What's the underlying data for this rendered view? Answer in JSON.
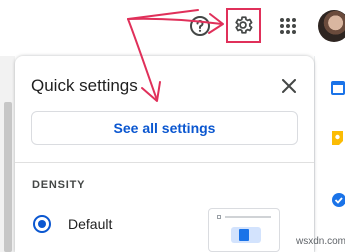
{
  "topbar": {
    "icons": [
      "help-icon",
      "settings-gear-icon",
      "apps-grid-icon",
      "avatar"
    ]
  },
  "quick_settings": {
    "title": "Quick settings",
    "see_all_label": "See all settings",
    "density": {
      "section_label": "DENSITY",
      "selected_option": "Default"
    }
  },
  "annotation": {
    "color": "#e0305a"
  },
  "watermark": "wsxdn.com",
  "colors": {
    "accent_blue": "#0b57d0",
    "annotation_pink": "#e0305a"
  }
}
